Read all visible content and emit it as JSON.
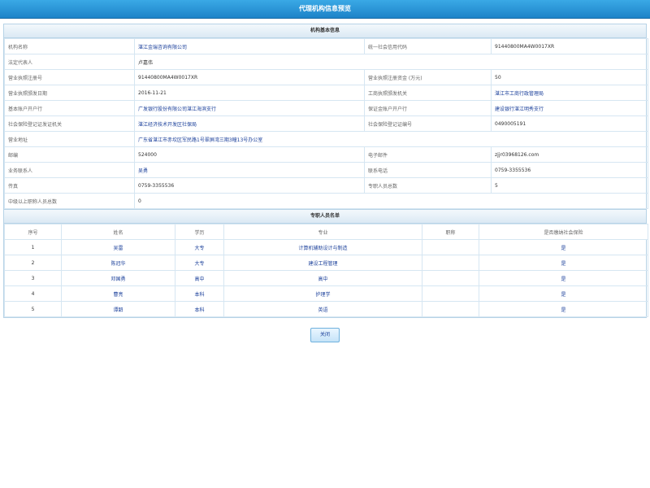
{
  "window": {
    "title": "代理机构信息预览"
  },
  "basic": {
    "section_title": "机构基本信息",
    "rows": [
      {
        "l1": "机构名称",
        "v1": "湛江金瑞咨询有限公司",
        "l2": "统一社会信用代码",
        "v2": "91440800MA4W0017XR"
      },
      {
        "l1": "法定代表人",
        "v1": "卢嘉伟",
        "l2": "",
        "v2": ""
      },
      {
        "l1": "营业执照注册号",
        "v1": "91440800MA4W0017XR",
        "l2": "营业执照注册资金 (万元)",
        "v2": "50"
      },
      {
        "l1": "营业执照颁发日期",
        "v1": "2016-11-21",
        "l2": "工商执照颁发机关",
        "v2": "湛江市工商行政管理局"
      },
      {
        "l1": "基本账户开户行",
        "v1": "广发银行股份有限公司湛江海滨支行",
        "l2": "保证金账户开户行",
        "v2": "建设银行湛江明秀支行"
      },
      {
        "l1": "社会保险登记证发证机关",
        "v1": "湛江经济技术开发区社保局",
        "l2": "社会保险登记证编号",
        "v2": "0490005191"
      },
      {
        "l1": "营业地址",
        "v1": "广东省湛江市赤坎区军民路1号翠屏湾三期3幢13号办公室",
        "l2": "",
        "v2": ""
      },
      {
        "l1": "邮编",
        "v1": "524000",
        "l2": "电子邮件",
        "v2": "zjjr03968126.com"
      },
      {
        "l1": "业务联系人",
        "v1": "吴勇",
        "l2": "联系电话",
        "v2": "0759-3355536"
      },
      {
        "l1": "传真",
        "v1": "0759-3355536",
        "l2": "专职人员总数",
        "v2": "5"
      },
      {
        "l1": "中级以上职称人员总数",
        "v1": "0",
        "l2": "",
        "v2": ""
      }
    ]
  },
  "staff": {
    "section_title": "专职人员名单",
    "headers": [
      "序号",
      "姓名",
      "学历",
      "专业",
      "职称",
      "是否缴纳社会保险"
    ],
    "rows": [
      {
        "no": "1",
        "name": "吴雷",
        "edu": "大专",
        "major": "计算机辅助设计与制造",
        "title": "",
        "ins": "是"
      },
      {
        "no": "2",
        "name": "陈冠华",
        "edu": "大专",
        "major": "建设工程管理",
        "title": "",
        "ins": "是"
      },
      {
        "no": "3",
        "name": "邓国勇",
        "edu": "高中",
        "major": "高中",
        "title": "",
        "ins": "是"
      },
      {
        "no": "4",
        "name": "曹亮",
        "edu": "本科",
        "major": "护理学",
        "title": "",
        "ins": "是"
      },
      {
        "no": "5",
        "name": "谭韶",
        "edu": "本科",
        "major": "英语",
        "title": "",
        "ins": "是"
      }
    ]
  },
  "actions": {
    "close_label": "关闭"
  }
}
